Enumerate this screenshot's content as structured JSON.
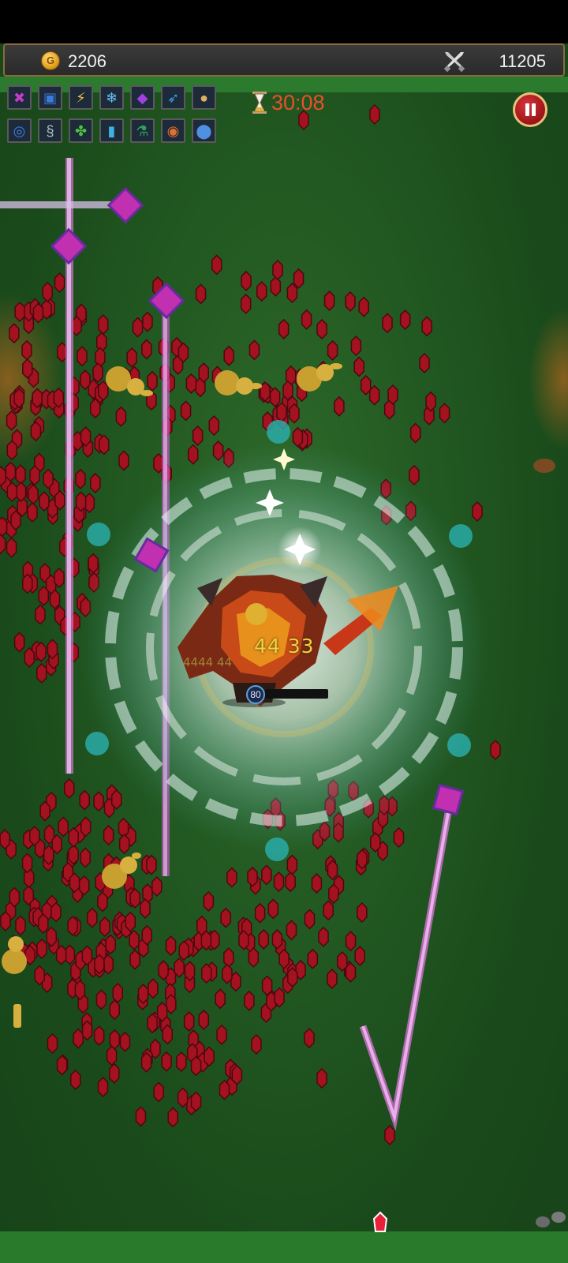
{
  "hud": {
    "gold": "2206",
    "kills": "11205",
    "timer": "30:08",
    "player_level": "80",
    "pause_label": "pause",
    "gold_icon": "gold-coin-icon",
    "kills_icon": "crossed-swords-icon",
    "timer_icon": "hourglass-icon"
  },
  "skills": {
    "row1": [
      {
        "icon": "crossed-arrows-skill-icon",
        "color": "#c63cc8"
      },
      {
        "icon": "spellbook-skill-icon",
        "color": "#3a7ad8"
      },
      {
        "icon": "lightning-blade-skill-icon",
        "color": "#f0c040"
      },
      {
        "icon": "frost-armor-skill-icon",
        "color": "#6ac0f0"
      },
      {
        "icon": "purple-crystal-skill-icon",
        "color": "#a040e0"
      },
      {
        "icon": "ice-wing-skill-icon",
        "color": "#3aa0f0"
      },
      {
        "icon": "gourd-skill-icon",
        "color": "#e0b060"
      }
    ],
    "row2": [
      {
        "icon": "blue-ring-item-icon",
        "color": "#3a80e8"
      },
      {
        "icon": "serpent-item-icon",
        "color": "#b0c0c0"
      },
      {
        "icon": "clover-item-icon",
        "color": "#50c040"
      },
      {
        "icon": "blue-scroll-item-icon",
        "color": "#40b0e0"
      },
      {
        "icon": "green-bottle-item-icon",
        "color": "#30a060"
      },
      {
        "icon": "fire-ring-item-icon",
        "color": "#e07030"
      },
      {
        "icon": "blue-potion-item-icon",
        "color": "#5090e0"
      }
    ]
  },
  "combat": {
    "damage_main": "44 33",
    "damage_faded": "4444 44"
  },
  "colors": {
    "field": "#235a22",
    "gem": "#a41220",
    "beam": "#d070d0",
    "aura": "#d8f0f0",
    "timer": "#e8502a"
  }
}
